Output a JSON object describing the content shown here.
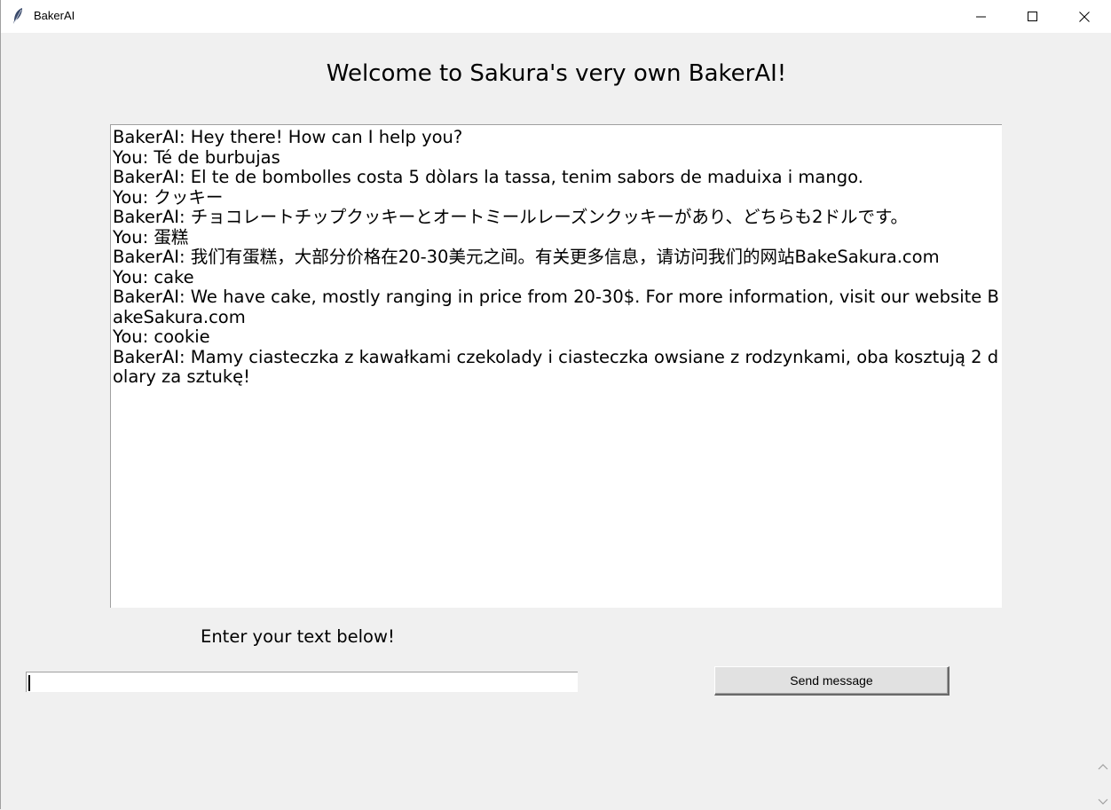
{
  "window": {
    "title": "BakerAI",
    "icon": "feather-icon",
    "controls": [
      "minimize-icon",
      "maximize-icon",
      "close-icon"
    ]
  },
  "header": {
    "welcome": "Welcome to Sakura's very own BakerAI!"
  },
  "chat": {
    "lines": [
      "BakerAI: Hey there! How can I help you?",
      "You: Té de burbujas",
      "BakerAI: El te de bombolles costa 5 dòlars la tassa, tenim sabors de maduixa i mango.",
      "You: クッキー",
      "BakerAI: チョコレートチップクッキーとオートミールレーズンクッキーがあり、どちらも2ドルです。",
      "You: 蛋糕",
      "BakerAI: 我们有蛋糕，大部分价格在20-30美元之间。有关更多信息，请访问我们的网站BakeSakura.com",
      "You: cake",
      "BakerAI: We have cake, mostly ranging in price from 20-30$. For more information, visit our website BakeSakura.com",
      "You: cookie",
      "BakerAI: Mamy ciasteczka z kawałkami czekolady i ciasteczka owsiane z rodzynkami, oba kosztują 2 dolary za sztukę!"
    ]
  },
  "input": {
    "label": "Enter your text below!",
    "value": ""
  },
  "send_button": {
    "label": "Send message"
  },
  "colors": {
    "window_bg": "#f0f0f0",
    "text_area_bg": "#ffffff",
    "button_bg": "#e1e1e1"
  }
}
